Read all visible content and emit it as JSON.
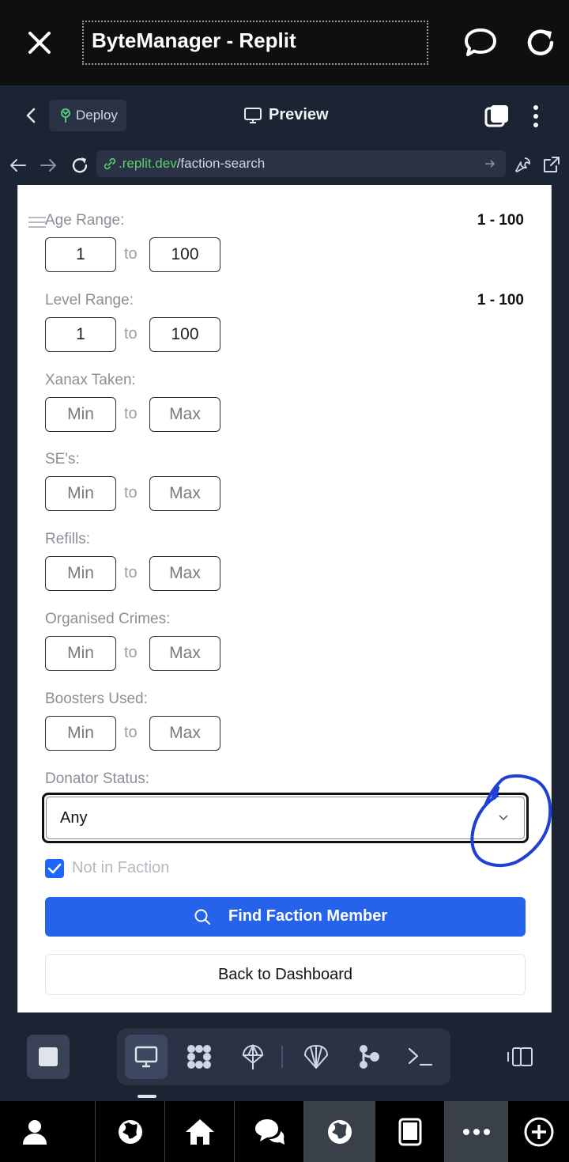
{
  "window": {
    "title": "ByteManager - Replit"
  },
  "replit": {
    "deploy_label": "Deploy",
    "preview_label": "Preview",
    "url_domain": ".replit.dev",
    "url_path": "/faction-search"
  },
  "form": {
    "age": {
      "label": "Age Range:",
      "summary": "1 - 100",
      "min": "1",
      "max": "100"
    },
    "level": {
      "label": "Level Range:",
      "summary": "1 - 100",
      "min": "1",
      "max": "100"
    },
    "xanax": {
      "label": "Xanax Taken:",
      "min_placeholder": "Min",
      "max_placeholder": "Max"
    },
    "se": {
      "label": "SE's:",
      "min_placeholder": "Min",
      "max_placeholder": "Max"
    },
    "refills": {
      "label": "Refills:",
      "min_placeholder": "Min",
      "max_placeholder": "Max"
    },
    "crimes": {
      "label": "Organised Crimes:",
      "min_placeholder": "Min",
      "max_placeholder": "Max"
    },
    "boosters": {
      "label": "Boosters Used:",
      "min_placeholder": "Min",
      "max_placeholder": "Max"
    },
    "to_text": "to",
    "donator": {
      "label": "Donator Status:",
      "value": "Any"
    },
    "not_in_faction": {
      "label": "Not in Faction",
      "checked": true
    },
    "find_button": "Find Faction Member",
    "back_button": "Back to Dashboard"
  },
  "colors": {
    "accent": "#2563eb",
    "replit_bg": "#1c2333",
    "url_green": "#5bd16a",
    "annotation": "#1f3fd6"
  },
  "icons": {
    "toolbar": [
      "stop-icon",
      "preview-monitor-icon",
      "workspace-icon",
      "deploy-icon",
      "shell-icon",
      "git-icon",
      "console-icon",
      "panel-toggle-icon"
    ],
    "bottom_nav": [
      "profile-icon",
      "globe-icon",
      "home-icon",
      "chat-icon",
      "globe-icon",
      "tablet-icon",
      "more-icon",
      "add-icon"
    ]
  }
}
